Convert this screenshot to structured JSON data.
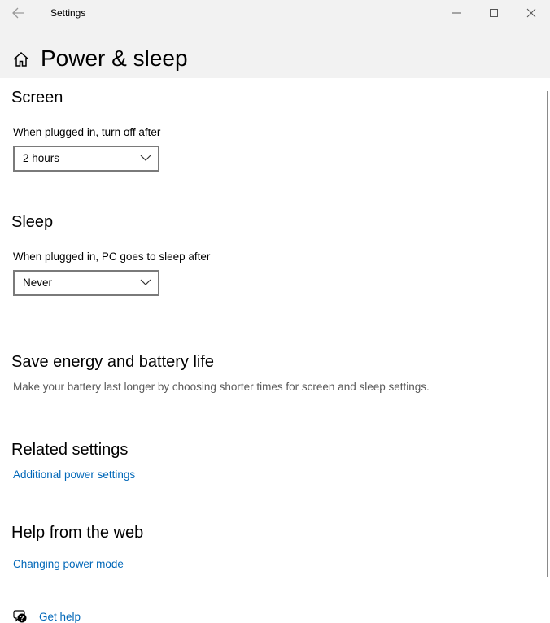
{
  "window": {
    "title": "Settings",
    "back_icon": "back-arrow-icon",
    "minimize_icon": "minimize-icon",
    "maximize_icon": "maximize-icon",
    "close_icon": "close-icon"
  },
  "header": {
    "home_icon": "home-icon",
    "title": "Power & sleep"
  },
  "screen": {
    "title": "Screen",
    "label": "When plugged in, turn off after",
    "selected": "2 hours"
  },
  "sleep": {
    "title": "Sleep",
    "label": "When plugged in, PC goes to sleep after",
    "selected": "Never"
  },
  "save_energy": {
    "title": "Save energy and battery life",
    "description": "Make your battery last longer by choosing shorter times for screen and sleep settings."
  },
  "related": {
    "title": "Related settings",
    "link": "Additional power settings"
  },
  "help_web": {
    "title": "Help from the web",
    "link": "Changing power mode"
  },
  "get_help": {
    "icon": "help-chat-icon",
    "label": "Get help"
  },
  "colors": {
    "link": "#0067b8",
    "header_bg": "#f2f2f2",
    "border": "#7a7a7a"
  }
}
